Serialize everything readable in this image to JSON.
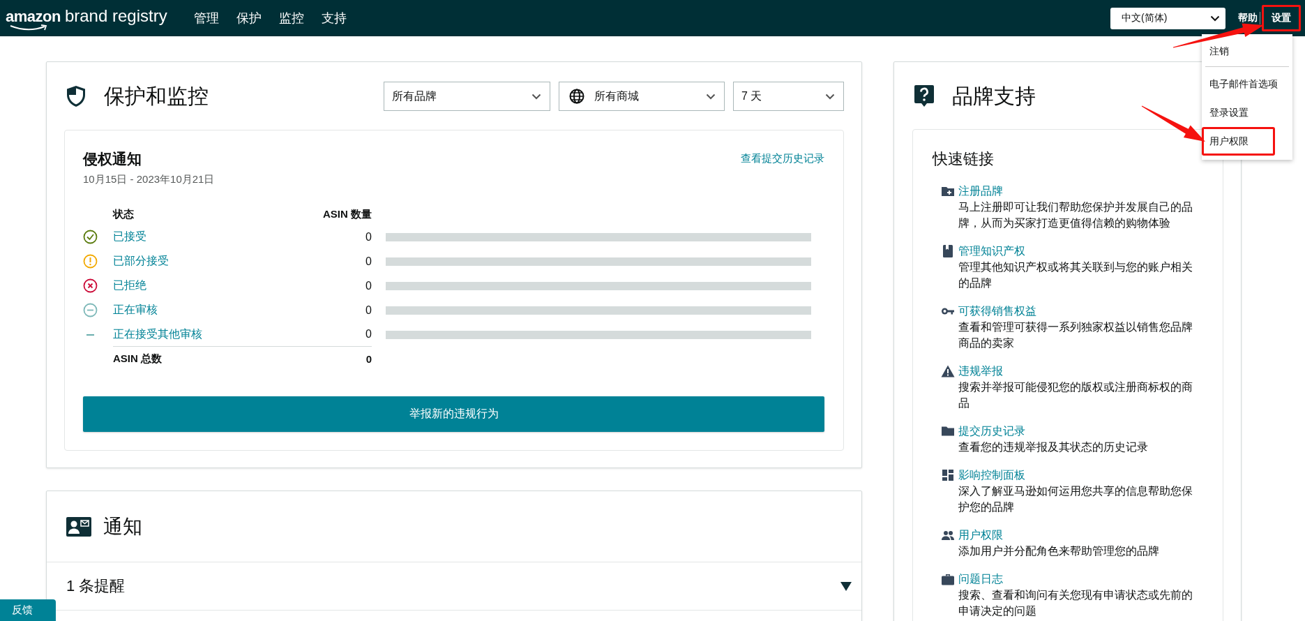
{
  "header": {
    "logo": {
      "word": "amazon",
      "suffix": "brand registry"
    },
    "nav": [
      "管理",
      "保护",
      "监控",
      "支持"
    ],
    "language": "中文(简体)",
    "help": "帮助",
    "settings": {
      "label": "设置",
      "annotated": true
    }
  },
  "settings_menu": {
    "items": [
      {
        "label": "注销",
        "annotated": false
      },
      {
        "label": "电子邮件首选项",
        "annotated": false
      },
      {
        "label": "登录设置",
        "annotated": false
      },
      {
        "label": "用户权限",
        "annotated": true
      }
    ]
  },
  "protection": {
    "title": "保护和监控",
    "filters": [
      {
        "label": "所有品牌",
        "kind": "plain"
      },
      {
        "label": "所有商城",
        "kind": "globe"
      },
      {
        "label": "7 天",
        "kind": "plain"
      }
    ],
    "notices": {
      "title": "侵权通知",
      "date_range": "10月15日 - 2023年10月21日",
      "link": "查看提交历史记录",
      "columns": [
        "状态",
        "ASIN 数量"
      ],
      "rows": [
        {
          "kind": "accepted",
          "label": "已接受",
          "count": "0",
          "level": 0
        },
        {
          "kind": "partial",
          "label": "已部分接受",
          "count": "0",
          "level": 0
        },
        {
          "kind": "rejected",
          "label": "已拒绝",
          "count": "0",
          "level": 0
        },
        {
          "kind": "review",
          "label": "正在审核",
          "count": "0",
          "level": 0
        },
        {
          "kind": "other",
          "label": "正在接受其他审核",
          "count": "0",
          "level": 0
        }
      ],
      "total_label": "ASIN 总数",
      "total": "0",
      "button": "举报新的违规行为"
    }
  },
  "notifications": {
    "title": "通知",
    "summary": "1 条提醒"
  },
  "support": {
    "title": "品牌支持",
    "quick_links": {
      "title": "快速链接",
      "items": [
        {
          "kind": "folder-plus",
          "title": "注册品牌",
          "description": "马上注册即可让我们帮助您保护并发展自己的品牌，从而为买家打造更值得信赖的购物体验"
        },
        {
          "kind": "book",
          "title": "管理知识产权",
          "description": "管理其他知识产权或将其关联到与您的账户相关的品牌"
        },
        {
          "kind": "key",
          "title": "可获得销售权益",
          "description": "查看和管理可获得一系列独家权益以销售您品牌商品的卖家"
        },
        {
          "kind": "warning",
          "title": "违规举报",
          "description": "搜索并举报可能侵犯您的版权或注册商标权的商品"
        },
        {
          "kind": "folder",
          "title": "提交历史记录",
          "description": "查看您的违规举报及其状态的历史记录"
        },
        {
          "kind": "dashboard",
          "title": "影响控制面板",
          "description": "深入了解亚马逊如何运用您共享的信息帮助您保护您的品牌"
        },
        {
          "kind": "people",
          "title": "用户权限",
          "description": "添加用户并分配角色来帮助管理您的品牌"
        },
        {
          "kind": "briefcase",
          "title": "问题日志",
          "description": "搜索、查看和询问有关您现有申请状态或先前的申请决定的问题"
        }
      ]
    }
  },
  "feedback": "反馈"
}
